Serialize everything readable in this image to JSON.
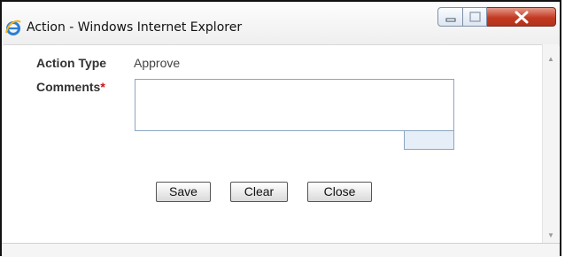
{
  "window": {
    "title": "Action - Windows Internet Explorer",
    "app_icon": "internet-explorer-icon",
    "controls": {
      "minimize_icon": "minimize-icon",
      "maximize_icon": "maximize-icon",
      "close_icon": "close-icon"
    }
  },
  "form": {
    "action_type_label": "Action Type",
    "action_type_value": "Approve",
    "comments_label": "Comments",
    "required_marker": "*",
    "comments_value": ""
  },
  "buttons": {
    "save": "Save",
    "clear": "Clear",
    "close": "Close"
  },
  "colors": {
    "required": "#cc1111",
    "close_button": "#c23a22",
    "textarea_border": "#8aa6c2"
  }
}
